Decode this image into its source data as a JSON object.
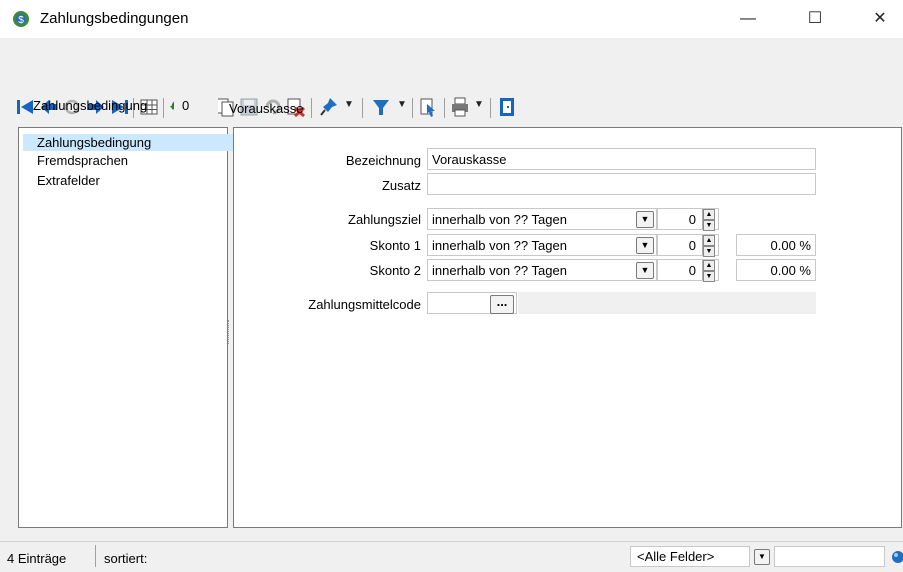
{
  "window": {
    "title": "Zahlungsbedingungen",
    "minimize": "—",
    "maximize": "☐",
    "close": "✕"
  },
  "header": {
    "label": "Zahlungsbedingung",
    "number": "0",
    "name": "Vorauskasse"
  },
  "nav": {
    "items": [
      {
        "label": "Zahlungsbedingung",
        "selected": true
      },
      {
        "label": "Fremdsprachen",
        "selected": false
      },
      {
        "label": "Extrafelder",
        "selected": false
      }
    ]
  },
  "form": {
    "bezeichnung_label": "Bezeichnung",
    "bezeichnung_value": "Vorauskasse",
    "zusatz_label": "Zusatz",
    "zusatz_value": "",
    "rows": [
      {
        "label": "Zahlungsziel",
        "select": "innerhalb von ?? Tagen",
        "days": "0",
        "percent": ""
      },
      {
        "label": "Skonto 1",
        "select": "innerhalb von ?? Tagen",
        "days": "0",
        "percent": "0.00 %"
      },
      {
        "label": "Skonto 2",
        "select": "innerhalb von ?? Tagen",
        "days": "0",
        "percent": "0.00 %"
      }
    ],
    "zahlungsmittelcode_label": "Zahlungsmittelcode",
    "zahlungsmittelcode_value": "",
    "browse_label": "..."
  },
  "status": {
    "count": "4 Einträge",
    "sort": "sortiert:",
    "filter_field": "<Alle Felder>",
    "search_value": ""
  },
  "colors": {
    "accent_blue": "#1565c0",
    "selection": "#cce8ff",
    "refresh_green": "#2e7d32",
    "delete_red": "#d32f2f"
  }
}
